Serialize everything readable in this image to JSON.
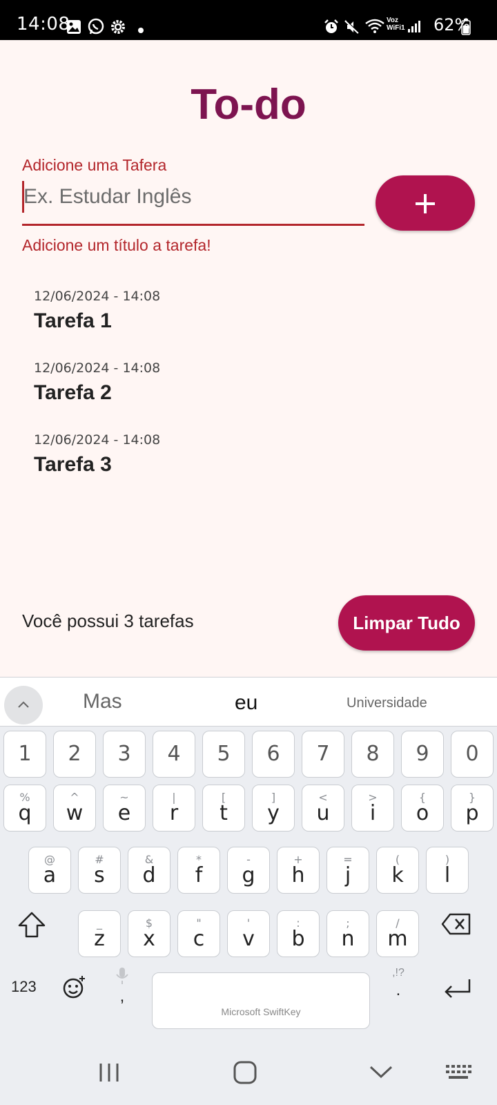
{
  "status_bar": {
    "time": "14:08",
    "battery_percent": "62%",
    "icons": [
      "gallery-icon",
      "whatsapp-icon",
      "settings-icon",
      "dot-icon",
      "alarm-icon",
      "mute-icon",
      "wifi-icon",
      "signal-icon",
      "battery-icon"
    ],
    "wifi_label_top": "Voz",
    "wifi_label_bottom": "WiFi1"
  },
  "app": {
    "title": "To-do",
    "input": {
      "label": "Adicione uma Tafera",
      "placeholder": "Ex. Estudar Inglês",
      "value": "",
      "error": "Adicione um título a tarefa!"
    },
    "add_button": {
      "label": "+"
    },
    "tasks": [
      {
        "date": "12/06/2024 - 14:08",
        "title": "Tarefa 1"
      },
      {
        "date": "12/06/2024 - 14:08",
        "title": "Tarefa 2"
      },
      {
        "date": "12/06/2024 - 14:08",
        "title": "Tarefa 3"
      }
    ],
    "summary": "Você possui 3 tarefas",
    "clear_button": {
      "label": "Limpar Tudo"
    }
  },
  "keyboard": {
    "suggestions": [
      "Mas",
      "eu",
      "Universidade"
    ],
    "number_row": [
      "1",
      "2",
      "3",
      "4",
      "5",
      "6",
      "7",
      "8",
      "9",
      "0"
    ],
    "row1": [
      {
        "p": "q",
        "s": "%"
      },
      {
        "p": "w",
        "s": "^"
      },
      {
        "p": "e",
        "s": "~"
      },
      {
        "p": "r",
        "s": "|"
      },
      {
        "p": "t",
        "s": "["
      },
      {
        "p": "y",
        "s": "]"
      },
      {
        "p": "u",
        "s": "<"
      },
      {
        "p": "i",
        "s": ">"
      },
      {
        "p": "o",
        "s": "{"
      },
      {
        "p": "p",
        "s": "}"
      }
    ],
    "row2": [
      {
        "p": "a",
        "s": "@"
      },
      {
        "p": "s",
        "s": "#"
      },
      {
        "p": "d",
        "s": "&"
      },
      {
        "p": "f",
        "s": "*"
      },
      {
        "p": "g",
        "s": "-"
      },
      {
        "p": "h",
        "s": "+"
      },
      {
        "p": "j",
        "s": "="
      },
      {
        "p": "k",
        "s": "("
      },
      {
        "p": "l",
        "s": ")"
      }
    ],
    "row3": [
      {
        "p": "z",
        "s": "_"
      },
      {
        "p": "x",
        "s": "$"
      },
      {
        "p": "c",
        "s": "\""
      },
      {
        "p": "v",
        "s": "'"
      },
      {
        "p": "b",
        "s": ":"
      },
      {
        "p": "n",
        "s": ";"
      },
      {
        "p": "m",
        "s": "/"
      }
    ],
    "symbols_key": "123",
    "comma_key": ",",
    "period_key": ".",
    "period_secondary": ",!?",
    "space_label": "Microsoft SwiftKey"
  }
}
